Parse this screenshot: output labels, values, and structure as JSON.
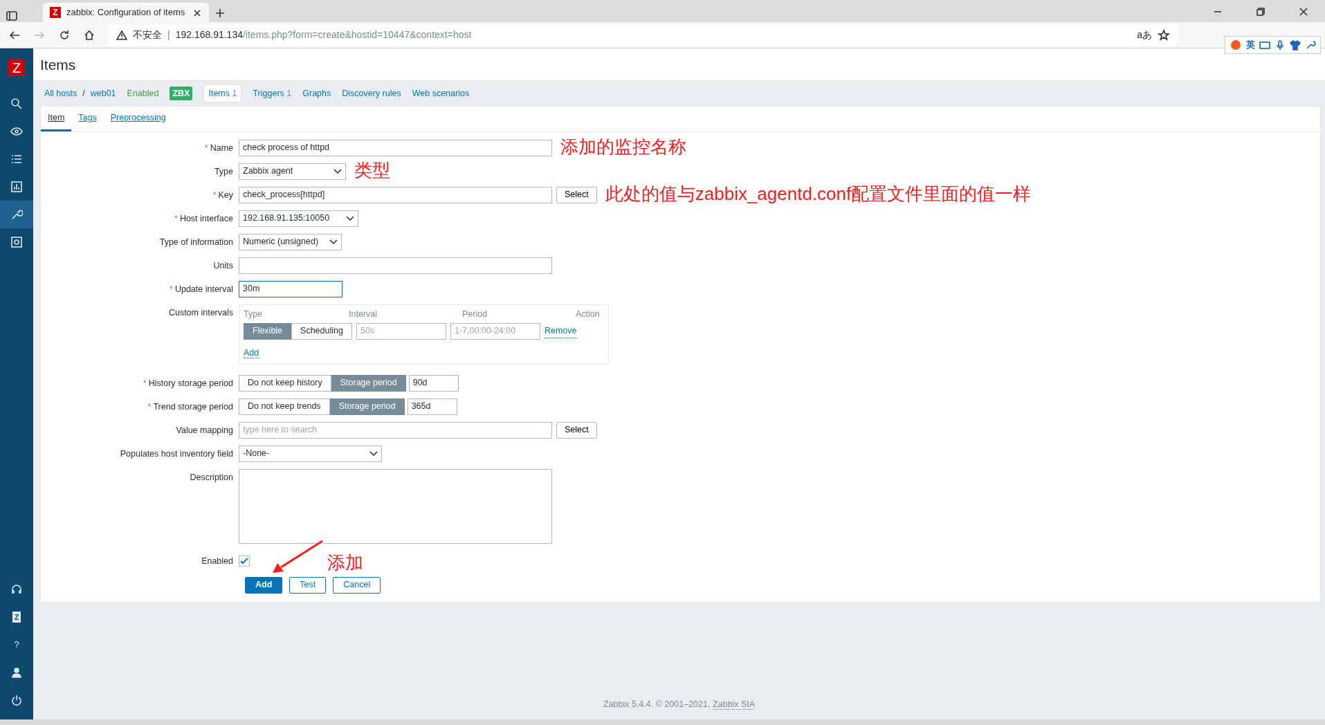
{
  "browser": {
    "favicon": "Z",
    "tab_title": "zabbix: Configuration of items",
    "security_label": "不安全",
    "url_divider": "|",
    "url_host": "192.168.91.134",
    "url_path": "/items.php?form=create&hostid=10447&context=host",
    "translate_label": "aあ"
  },
  "ime_toolbar": {
    "language": "英"
  },
  "sidebar": {
    "logo": "Z",
    "integrations_label": "Z",
    "help_label": "?"
  },
  "header": {
    "title": "Items"
  },
  "breadcrumb": {
    "all_hosts": "All hosts",
    "separator": "/",
    "host": "web01",
    "status": "Enabled",
    "agent_badge": "ZBX",
    "links": [
      {
        "label": "Items",
        "count": "1",
        "selected": true
      },
      {
        "label": "Triggers",
        "count": "1",
        "selected": false
      },
      {
        "label": "Graphs",
        "selected": false
      },
      {
        "label": "Discovery rules",
        "selected": false
      },
      {
        "label": "Web scenarios",
        "selected": false
      }
    ]
  },
  "form_tabs": [
    {
      "label": "Item",
      "selected": true
    },
    {
      "label": "Tags",
      "selected": false
    },
    {
      "label": "Preprocessing",
      "selected": false
    }
  ],
  "fields": [
    {
      "kind": "text",
      "label": "Name",
      "required_mark": "*",
      "value": "check process of httpd",
      "annotation": "添加的监控名称"
    },
    {
      "kind": "select",
      "label": "Type",
      "value": "Zabbix agent",
      "annotation": "类型"
    },
    {
      "kind": "text_button",
      "label": "Key",
      "required_mark": "*",
      "value": "check_process[httpd]",
      "button": "Select",
      "annotation": "此处的值与zabbix_agentd.conf配置文件里面的值一样"
    },
    {
      "kind": "select",
      "label": "Host interface",
      "required_mark": "*",
      "value": "192.168.91.135:10050"
    },
    {
      "kind": "select",
      "label": "Type of information",
      "value": "Numeric (unsigned)"
    },
    {
      "kind": "text",
      "label": "Units"
    },
    {
      "kind": "text",
      "label": "Update interval",
      "required_mark": "*",
      "value": "30m",
      "focused": true
    },
    {
      "kind": "custom_intervals",
      "label": "Custom intervals",
      "columns": [
        "Type",
        "Interval",
        "Period",
        "Action"
      ],
      "rows": [
        {
          "modes": [
            {
              "label": "Flexible",
              "selected": true
            },
            {
              "label": "Scheduling",
              "selected": false
            }
          ],
          "interval_placeholder": "50s",
          "period_placeholder": "1-7,00:00-24:00",
          "action": "Remove"
        }
      ],
      "add_link": "Add"
    },
    {
      "kind": "storage",
      "label": "History storage period",
      "required_mark": "*",
      "options": [
        {
          "label": "Do not keep history",
          "selected": false
        },
        {
          "label": "Storage period",
          "selected": true
        }
      ],
      "value": "90d"
    },
    {
      "kind": "storage",
      "label": "Trend storage period",
      "required_mark": "*",
      "options": [
        {
          "label": "Do not keep trends",
          "selected": false
        },
        {
          "label": "Storage period",
          "selected": true
        }
      ],
      "value": "365d"
    },
    {
      "kind": "text_button",
      "label": "Value mapping",
      "placeholder": "type here to search",
      "button": "Select"
    },
    {
      "kind": "select",
      "label": "Populates host inventory field",
      "value": "-None-"
    },
    {
      "kind": "textarea",
      "label": "Description"
    },
    {
      "kind": "checkbox",
      "label": "Enabled",
      "checked": true,
      "annotation": "添加"
    }
  ],
  "buttons": [
    {
      "label": "Add",
      "primary": true
    },
    {
      "label": "Test",
      "primary": false
    },
    {
      "label": "Cancel",
      "primary": false
    }
  ],
  "footer": {
    "text": "Zabbix 5.4.4. © 2001–2021, ",
    "link": "Zabbix SIA"
  }
}
